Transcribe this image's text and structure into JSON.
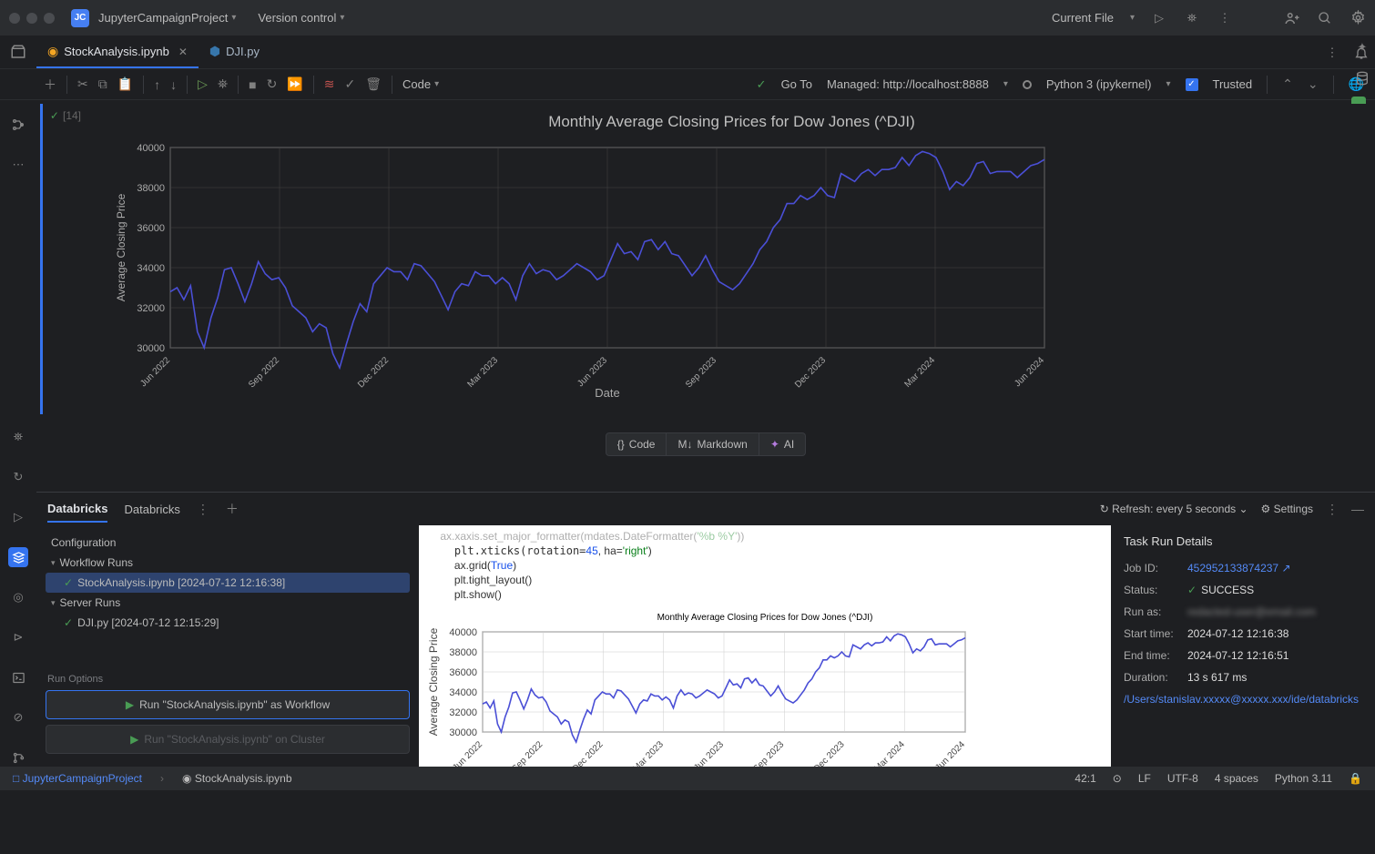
{
  "titlebar": {
    "project_badge": "JC",
    "project_name": "JupyterCampaignProject",
    "vcs": "Version control",
    "current_file": "Current File"
  },
  "tabs": [
    {
      "icon": "notebook",
      "label": "StockAnalysis.ipynb",
      "active": true
    },
    {
      "icon": "python",
      "label": "DJI.py",
      "active": false
    }
  ],
  "toolbar": {
    "cell_type": "Code",
    "goto": "Go To",
    "managed": "Managed: http://localhost:8888",
    "kernel": "Python 3 (ipykernel)",
    "trusted": "Trusted"
  },
  "cell": {
    "exec_count": "[14]"
  },
  "add_buttons": {
    "code": "Code",
    "markdown": "Markdown",
    "ai": "AI"
  },
  "chart_data": {
    "type": "line",
    "title": "Monthly Average Closing Prices for Dow Jones (^DJI)",
    "xlabel": "Date",
    "ylabel": "Average Closing Price",
    "ylim": [
      30000,
      40000
    ],
    "ticks_y": [
      30000,
      32000,
      34000,
      36000,
      38000,
      40000
    ],
    "categories": [
      "Jun 2022",
      "Sep 2022",
      "Dec 2022",
      "Mar 2023",
      "Jun 2023",
      "Sep 2023",
      "Dec 2023",
      "Mar 2024",
      "Jun 2024"
    ],
    "values": [
      32800,
      33000,
      32400,
      33100,
      30800,
      30000,
      31500,
      32500,
      33900,
      34000,
      33200,
      32300,
      33200,
      34300,
      33700,
      33400,
      33500,
      33000,
      32100,
      31800,
      31500,
      30800,
      31200,
      31000,
      29700,
      29000,
      30200,
      31300,
      32200,
      31800,
      33200,
      33600,
      34000,
      33800,
      33800,
      33400,
      34200,
      34100,
      33700,
      33300,
      32600,
      31900,
      32800,
      33200,
      33100,
      33800,
      33600,
      33600,
      33200,
      33500,
      33200,
      32400,
      33600,
      34200,
      33700,
      33900,
      33800,
      33400,
      33600,
      33900,
      34200,
      34000,
      33800,
      33400,
      33600,
      34400,
      35200,
      34700,
      34800,
      34400,
      35300,
      35400,
      34900,
      35300,
      34700,
      34600,
      34100,
      33600,
      34000,
      34600,
      33900,
      33300,
      33100,
      32900,
      33200,
      33700,
      34200,
      34900,
      35300,
      36000,
      36400,
      37200,
      37200,
      37600,
      37400,
      37600,
      38000,
      37600,
      37500,
      38700,
      38500,
      38300,
      38700,
      38900,
      38600,
      38900,
      38900,
      39000,
      39500,
      39100,
      39600,
      39800,
      39700,
      39500,
      38800,
      37900,
      38300,
      38100,
      38500,
      39200,
      39300,
      38700,
      38800,
      38800,
      38800,
      38500,
      38800,
      39100,
      39200,
      39400
    ]
  },
  "panel": {
    "tab1": "Databricks",
    "tab2": "Databricks",
    "refresh": "Refresh: every 5 seconds",
    "settings": "Settings",
    "configuration": "Configuration",
    "workflow_runs": "Workflow Runs",
    "wf_item": "StockAnalysis.ipynb [2024-07-12 12:16:38]",
    "server_runs": "Server Runs",
    "sr_item": "DJI.py [2024-07-12 12:15:29]",
    "run_options": "Run Options",
    "run_wf": "Run \"StockAnalysis.ipynb\" as Workflow",
    "run_cluster": "Run \"StockAnalysis.ipynb\" on Cluster"
  },
  "code_snippet": {
    "l1": "ax.xaxis.set_major_formatter(mdates.DateFormatter('%b %Y'))",
    "l2a": "plt.xticks(rotation=",
    "l2num": "45",
    "l2b": ", ha=",
    "l2str": "'right'",
    "l2c": ")",
    "l3a": "ax.grid(",
    "l3kw": "True",
    "l3b": ")",
    "l4": "plt.tight_layout()",
    "l5": "plt.show()"
  },
  "details": {
    "header": "Task Run Details",
    "job_id_label": "Job ID:",
    "job_id": "452952133874237",
    "status_label": "Status:",
    "status": "SUCCESS",
    "run_as_label": "Run as:",
    "run_as": "redacted-user@email.com",
    "start_label": "Start time:",
    "start": "2024-07-12 12:16:38",
    "end_label": "End time:",
    "end": "2024-07-12 12:16:51",
    "dur_label": "Duration:",
    "dur": "13 s 617 ms",
    "path": "/Users/stanislav.xxxxx@xxxxx.xxx/ide/databricks"
  },
  "statusbar": {
    "project": "JupyterCampaignProject",
    "file": "StockAnalysis.ipynb",
    "pos": "42:1",
    "le": "LF",
    "enc": "UTF-8",
    "indent": "4 spaces",
    "py": "Python 3.11"
  }
}
